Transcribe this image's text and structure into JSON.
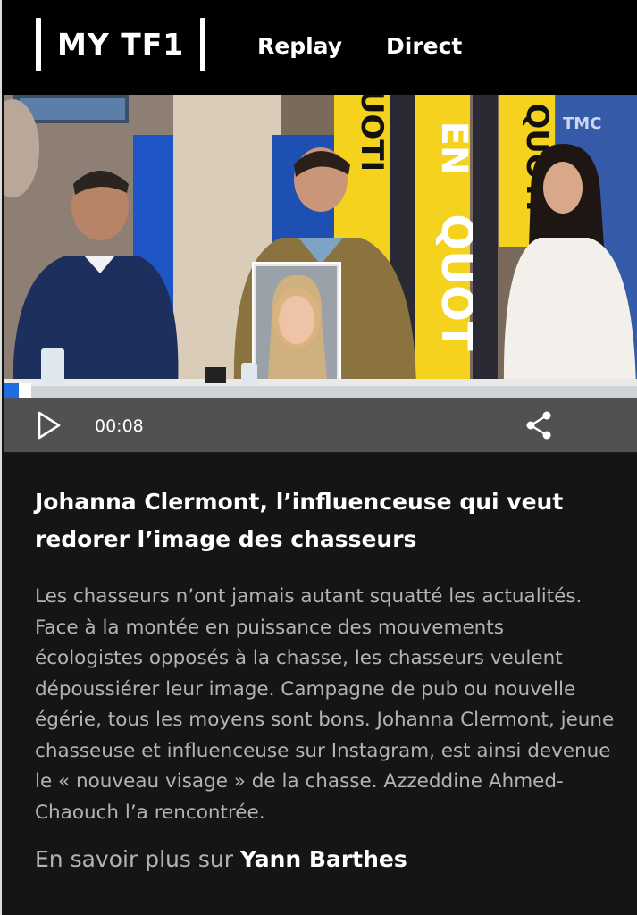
{
  "header": {
    "logo_text": "MY TF1",
    "nav": [
      {
        "label": "Replay"
      },
      {
        "label": "Direct"
      }
    ]
  },
  "player": {
    "current_time": "00:08",
    "progress_fraction": 0.03,
    "channel_watermark": "TMC",
    "set_sign": "QUOTIDIEN",
    "play_icon": "play-icon",
    "share_icon": "share-icon"
  },
  "article": {
    "title": "Johanna Clermont, l’influenceuse qui veut redorer l’image des chasseurs",
    "description": "Les chasseurs n’ont jamais autant squatté les actualités. Face à la montée en puissance des mouvements écologistes opposés à la chasse, les chasseurs veulent dépoussiérer leur image. Campagne de pub ou nouvelle égérie, tous les moyens sont bons. Johanna Clermont, jeune chasseuse et influenceuse sur Instagram, est ainsi devenue le « nouveau visage » de la chasse. Azzeddine Ahmed-Chaouch l’a rencontrée.",
    "more_prefix": "En savoir plus sur",
    "more_name": "Yann Barthes"
  },
  "colors": {
    "header_bg": "#000000",
    "page_bg": "#151515",
    "text_muted": "#b3b3b3",
    "progress": "#1d6fe0",
    "sign_yellow": "#f4d21e"
  }
}
